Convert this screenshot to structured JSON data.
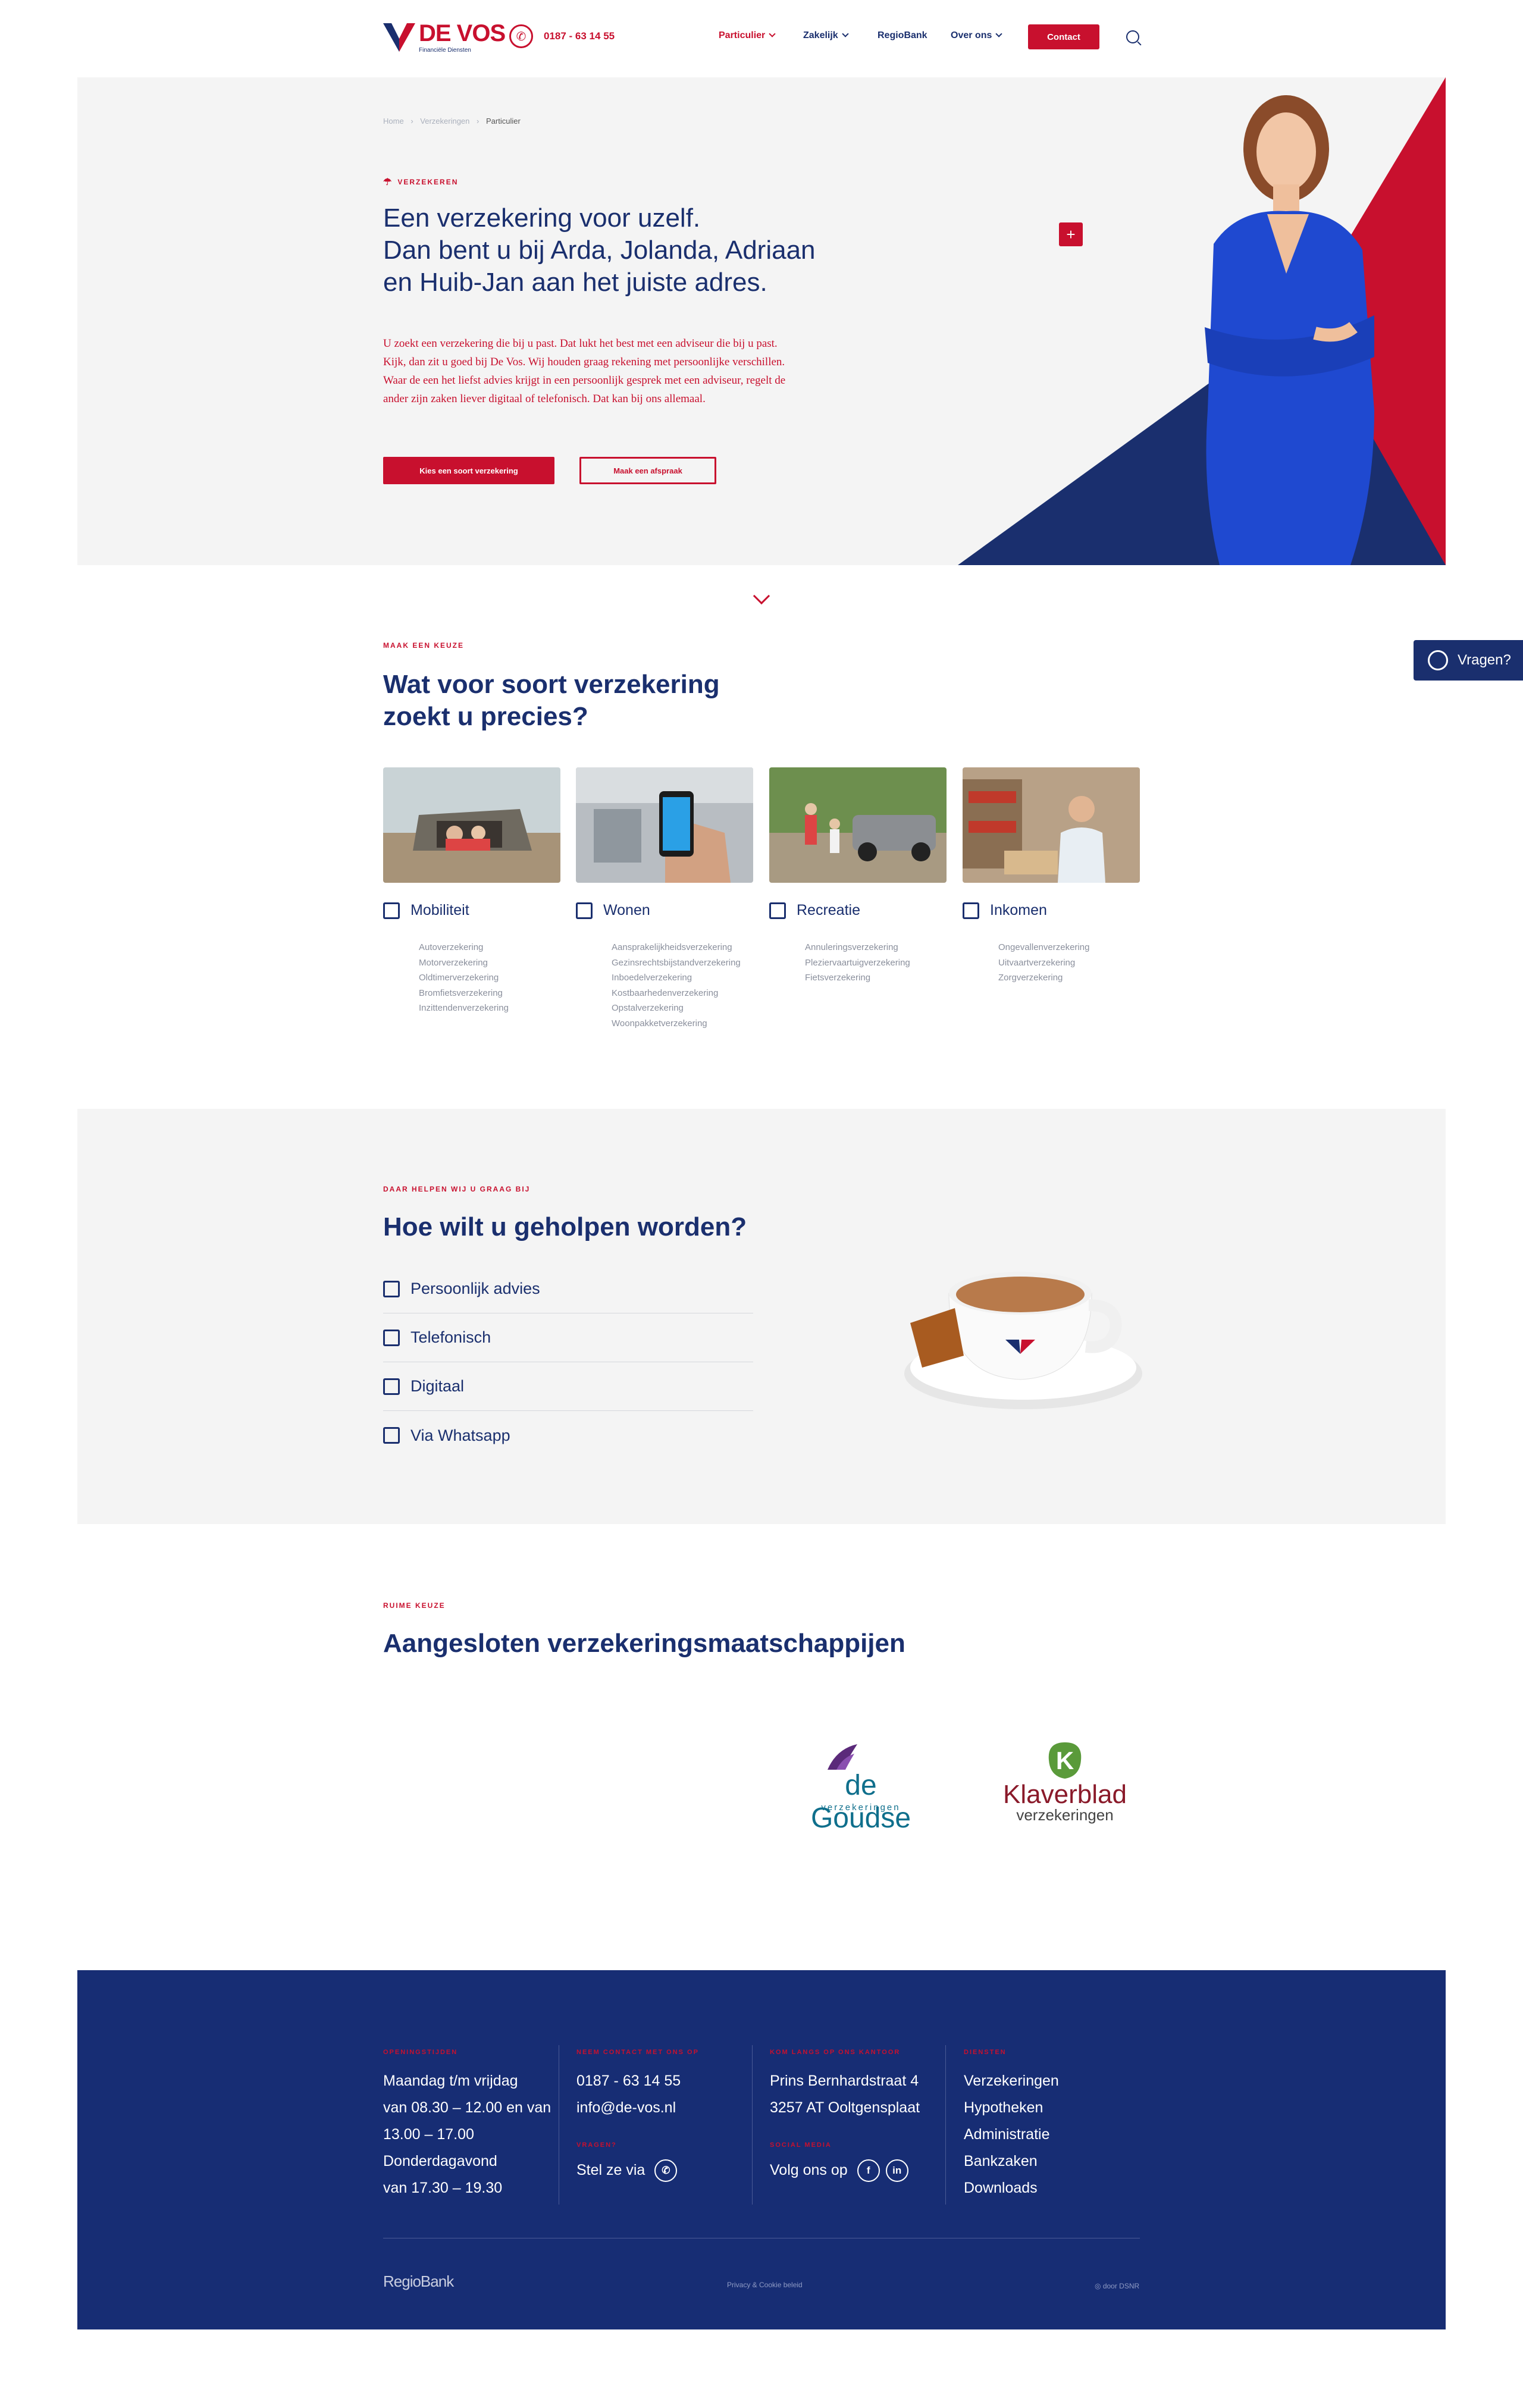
{
  "header": {
    "logo_text": "DE VOS",
    "logo_tagline": "Financiële Diensten",
    "phone": "0187 - 63 14 55",
    "nav": [
      {
        "label": "Particulier"
      },
      {
        "label": "Zakelijk"
      },
      {
        "label": "RegioBank"
      },
      {
        "label": "Over ons"
      }
    ],
    "contact_label": "Contact",
    "search_icon": "search-icon"
  },
  "hero": {
    "breadcrumb": [
      "Home",
      "Verzekeringen",
      "Particulier"
    ],
    "eyebrow": "Verzekeren",
    "title": "Een verzekering voor uzelf.\nDan bent u bij Arda, Jolanda, Adriaan\nen Huib-Jan aan het juiste adres.",
    "text": "U zoekt een verzekering die bij u past. Dat lukt het best met een adviseur die bij u past. Kijk, dan zit u goed bij De Vos. Wij houden graag rekening met persoonlijke verschillen. Waar de een het liefst advies krijgt in een persoonlijk gesprek met een adviseur, regelt de ander zijn zaken liever digitaal of telefonisch. Dat kan bij ons allemaal.",
    "btn_primary": "Kies een soort verzekering",
    "btn_secondary": "Maak een afspraak",
    "plus": "+",
    "colors": {
      "red": "#c8102e",
      "navy": "#1a2f6e",
      "dress": "#1f49d0"
    }
  },
  "choose": {
    "eyebrow": "Maak een keuze",
    "title": "Wat voor soort verzekering\nzoekt u precies?",
    "categories": [
      {
        "title": "Mobiliteit",
        "items": [
          "Autoverzekering",
          "Motorverzekering",
          "Oldtimerverzekering",
          "Bromfietsverzekering",
          "Inzittendenverzekering"
        ]
      },
      {
        "title": "Wonen",
        "items": [
          "Aansprakelijkheidsverzekering",
          "Gezinsrechtsbijstandverzekering",
          "Inboedelverzekering",
          "Kostbaarhedenverzekering",
          "Opstalverzekering",
          "Woonpakketverzekering"
        ]
      },
      {
        "title": "Recreatie",
        "items": [
          "Annuleringsverzekering",
          "Pleziervaartuigverzekering",
          "Fietsverzekering"
        ]
      },
      {
        "title": "Inkomen",
        "items": [
          "Ongevallenverzekering",
          "Uitvaartverzekering",
          "Zorgverzekering"
        ]
      }
    ]
  },
  "help": {
    "eyebrow": "Daar helpen wij u graag bij",
    "title": "Hoe wilt u geholpen worden?",
    "options": [
      "Persoonlijk advies",
      "Telefonisch",
      "Digitaal",
      "Via Whatsapp"
    ]
  },
  "insurers": {
    "eyebrow": "Ruime keuze",
    "title": "Aangesloten verzekeringsmaatschappijen",
    "logos": [
      {
        "name": "de Goudse",
        "sub": "verzekeringen"
      },
      {
        "name": "Klaverblad",
        "sub": "verzekeringen"
      }
    ]
  },
  "whatsapp_tab": {
    "label": "Vragen?"
  },
  "footer": {
    "cols": [
      {
        "eyebrow": "Openingstijden",
        "lines": [
          "Maandag t/m vrijdag",
          "van 08.30 – 12.00 en van",
          "13.00 – 17.00",
          "Donderdagavond",
          "van 17.30 – 19.30"
        ]
      },
      {
        "eyebrow": "Neem contact met ons op",
        "lines": [
          "0187 - 63 14 55",
          "info@de-vos.nl"
        ],
        "eyebrow2": "Vragen?",
        "extra": "Stel ze via"
      },
      {
        "eyebrow": "Kom langs op ons kantoor",
        "lines": [
          "Prins Bernhardstraat 4",
          "3257 AT Ooltgensplaat"
        ],
        "eyebrow2": "Social media",
        "extra": "Volg ons op"
      },
      {
        "eyebrow": "Diensten",
        "lines": [
          "Verzekeringen",
          "Hypotheken",
          "Administratie",
          "Bankzaken",
          "Downloads"
        ]
      }
    ],
    "regiobank": "RegioBank",
    "privacy": "Privacy & Cookie beleid",
    "credit": "door DSNR"
  }
}
